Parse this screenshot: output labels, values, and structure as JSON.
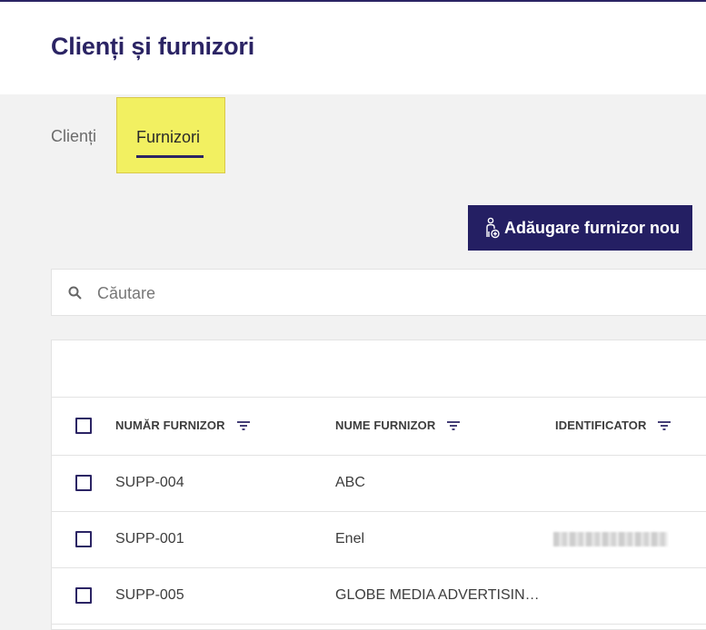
{
  "header": {
    "title": "Clienți și furnizori"
  },
  "tabs": [
    {
      "label": "Clienți",
      "active": false
    },
    {
      "label": "Furnizori",
      "active": true
    }
  ],
  "actions": {
    "add_supplier": "Adăugare furnizor nou",
    "add_icon": "person-add-icon"
  },
  "search": {
    "placeholder": "Căutare",
    "value": ""
  },
  "table": {
    "columns": [
      {
        "label": "NUMĂR FURNIZOR",
        "icon": "filter-icon"
      },
      {
        "label": "NUME FURNIZOR",
        "icon": "filter-icon"
      },
      {
        "label": "IDENTIFICATOR",
        "icon": "filter-icon"
      }
    ],
    "rows": [
      {
        "number": "SUPP-004",
        "name": "ABC",
        "identifier": ""
      },
      {
        "number": "SUPP-001",
        "name": "Enel",
        "identifier": ""
      },
      {
        "number": "SUPP-005",
        "name": "GLOBE MEDIA ADVERTISIN…",
        "identifier": ""
      }
    ]
  },
  "colors": {
    "brand": "#2b2464",
    "highlight": "#f2f061"
  }
}
